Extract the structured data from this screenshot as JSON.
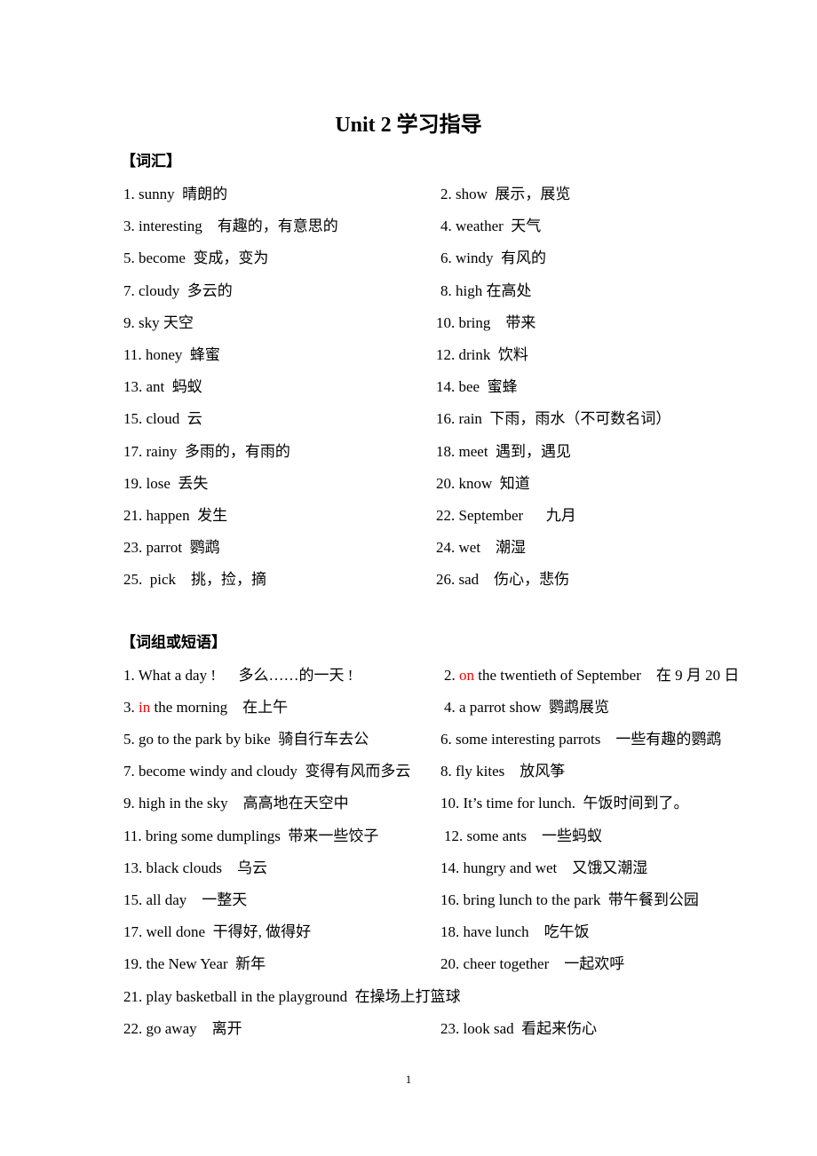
{
  "title": "Unit 2  学习指导",
  "vocab": {
    "heading": "【词汇】",
    "rows": [
      [
        "1. sunny  晴朗的",
        "2. show  展示，展览"
      ],
      [
        "3. interesting    有趣的，有意思的",
        "4. weather  天气"
      ],
      [
        "5. become  变成，变为",
        "6. windy  有风的"
      ],
      [
        "7. cloudy  多云的",
        "8. high 在高处"
      ],
      [
        "9. sky 天空",
        "10. bring    带来"
      ],
      [
        "11. honey  蜂蜜",
        "12. drink  饮料"
      ],
      [
        "13. ant  蚂蚁",
        "14. bee  蜜蜂"
      ],
      [
        "15. cloud  云",
        "16. rain  下雨，雨水（不可数名词）"
      ],
      [
        "17. rainy  多雨的，有雨的",
        "18. meet  遇到，遇见"
      ],
      [
        "19. lose  丢失",
        "20. know  知道"
      ],
      [
        "21. happen  发生",
        "22. September      九月"
      ],
      [
        "23. parrot  鹦鹉",
        "24. wet    潮湿"
      ],
      [
        "25.  pick    挑，捡，摘",
        "26. sad    伤心，悲伤"
      ]
    ]
  },
  "phrases": {
    "heading": "【词组或短语】",
    "p1": "1. What a day !      多么……的一天 !",
    "p2_num": "2. ",
    "p2_red": "on",
    "p2_rest": " the twentieth of September    在 9 月 20 日",
    "p3_num": "3. ",
    "p3_red": "in",
    "p3_rest": " the morning    在上午",
    "p4": "4. a parrot show  鹦鹉展览",
    "rows": [
      [
        "5. go to the park by bike  骑自行车去公",
        "6. some interesting parrots    一些有趣的鹦鹉"
      ],
      [
        "7. become windy and cloudy  变得有风而多云",
        "8. fly kites    放风筝"
      ],
      [
        "9. high in the sky    高高地在天空中",
        "10. It’s time for lunch.  午饭时间到了。"
      ],
      [
        "11. bring some dumplings  带来一些饺子",
        "12. some ants    一些蚂蚁"
      ],
      [
        "13. black clouds    乌云",
        "14. hungry and wet    又饿又潮湿"
      ],
      [
        "15. all day    一整天",
        "16. bring lunch to the park  带午餐到公园"
      ],
      [
        "17. well done  干得好, 做得好",
        "18. have lunch    吃午饭"
      ],
      [
        "19. the New Year  新年",
        "20. cheer together    一起欢呼"
      ]
    ],
    "p21": "21. play basketball in the playground  在操场上打篮球",
    "p22": "22. go away    离开",
    "p23": "23. look sad  看起来伤心"
  },
  "highlight_color": "#ff0000",
  "page_number": "1"
}
